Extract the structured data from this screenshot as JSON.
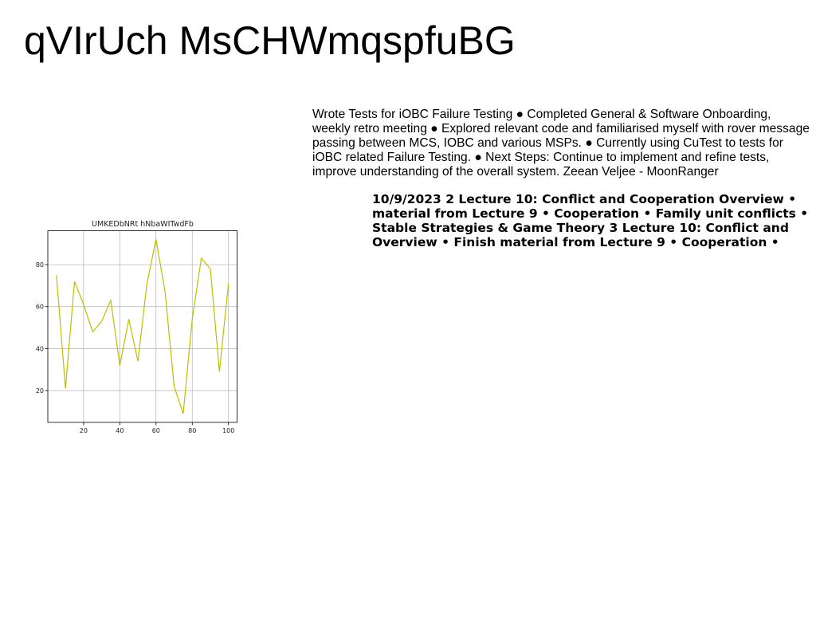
{
  "page": {
    "title": "qVIrUch MsCHWmqspfuBG"
  },
  "report": {
    "text": "Wrote Tests for iOBC Failure Testing ● Completed General & Software Onboarding, weekly retro meeting ● Explored relevant code and familiarised myself with rover message passing between MCS, IOBC and various MSPs. ● Currently using CuTest to tests for iOBC related Failure Testing. ● Next Steps: Continue to implement and refine tests, improve understanding of the overall system. Zeean Veljee - MoonRanger"
  },
  "lecture": {
    "lines": [
      "10/9/2023 2 Lecture 10: Conflict and Cooperation Overview •",
      "material from Lecture 9 • Cooperation • Family unit conflicts •",
      "Stable Strategies & Game Theory 3 Lecture 10: Conflict and",
      "Overview • Finish material from Lecture 9 • Cooperation •"
    ]
  },
  "chart_data": {
    "type": "line",
    "title": "UMKEDbNRt hNbaWITwdFb",
    "xlabel": "",
    "ylabel": "",
    "x": [
      5,
      10,
      15,
      20,
      25,
      30,
      35,
      40,
      45,
      50,
      55,
      60,
      65,
      70,
      75,
      80,
      85,
      90,
      95,
      100
    ],
    "series": [
      {
        "values": [
          75,
          21,
          72,
          61,
          48,
          53,
          63,
          32,
          54,
          34,
          71,
          92,
          67,
          22,
          9,
          54,
          83,
          78,
          29,
          71
        ]
      }
    ],
    "xlim": [
      0.25,
      104.75
    ],
    "ylim": [
      4.85,
      96.15
    ],
    "xticks": [
      20,
      40,
      60,
      80,
      100
    ],
    "yticks": [
      20,
      40,
      60,
      80
    ],
    "grid": true,
    "colors": {
      "line": "#bfbf00",
      "grid": "#b0b0b0",
      "axes": "#000000",
      "text": "#222222"
    }
  }
}
